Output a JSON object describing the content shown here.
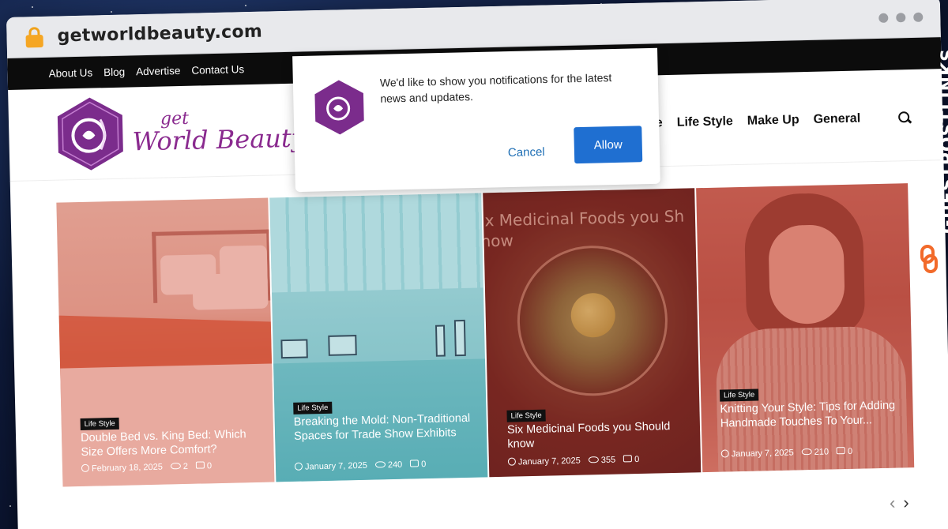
{
  "browser": {
    "url": "getworldbeauty.com"
  },
  "topbar": {
    "items": [
      "About Us",
      "Blog",
      "Advertise",
      "Contact Us"
    ]
  },
  "logo": {
    "line1": "get",
    "line2": "World Beauty"
  },
  "nav": {
    "items": [
      "ome",
      "Life Style",
      "Make Up",
      "General"
    ]
  },
  "popup": {
    "message": "We'd like to show you notifications for the latest news and updates.",
    "cancel": "Cancel",
    "allow": "Allow"
  },
  "cards": [
    {
      "tag": "Life Style",
      "title": "Double Bed vs. King Bed: Which Size Offers More Comfort?",
      "date": "February 18, 2025",
      "views": "2",
      "comments": "0"
    },
    {
      "tag": "Life Style",
      "title": "Breaking the Mold: Non-Traditional Spaces for Trade Show Exhibits",
      "date": "January 7, 2025",
      "views": "240",
      "comments": "0"
    },
    {
      "tag": "Life Style",
      "title": "Six Medicinal Foods you Should know",
      "date": "January 7, 2025",
      "views": "355",
      "comments": "0",
      "image_text": [
        "ix Medicinal Foods you Sh",
        "now"
      ]
    },
    {
      "tag": "Life Style",
      "title": "Knitting Your Style: Tips for Adding Handmade Touches To Your...",
      "date": "January 7, 2025",
      "views": "210",
      "comments": "0"
    }
  ],
  "watermark": {
    "text": "GUESTPOSTLINKS"
  },
  "colors": {
    "brand_purple": "#8a2a8f",
    "allow_blue": "#1f6fd1",
    "watermark_orange": "#f26a2a"
  }
}
